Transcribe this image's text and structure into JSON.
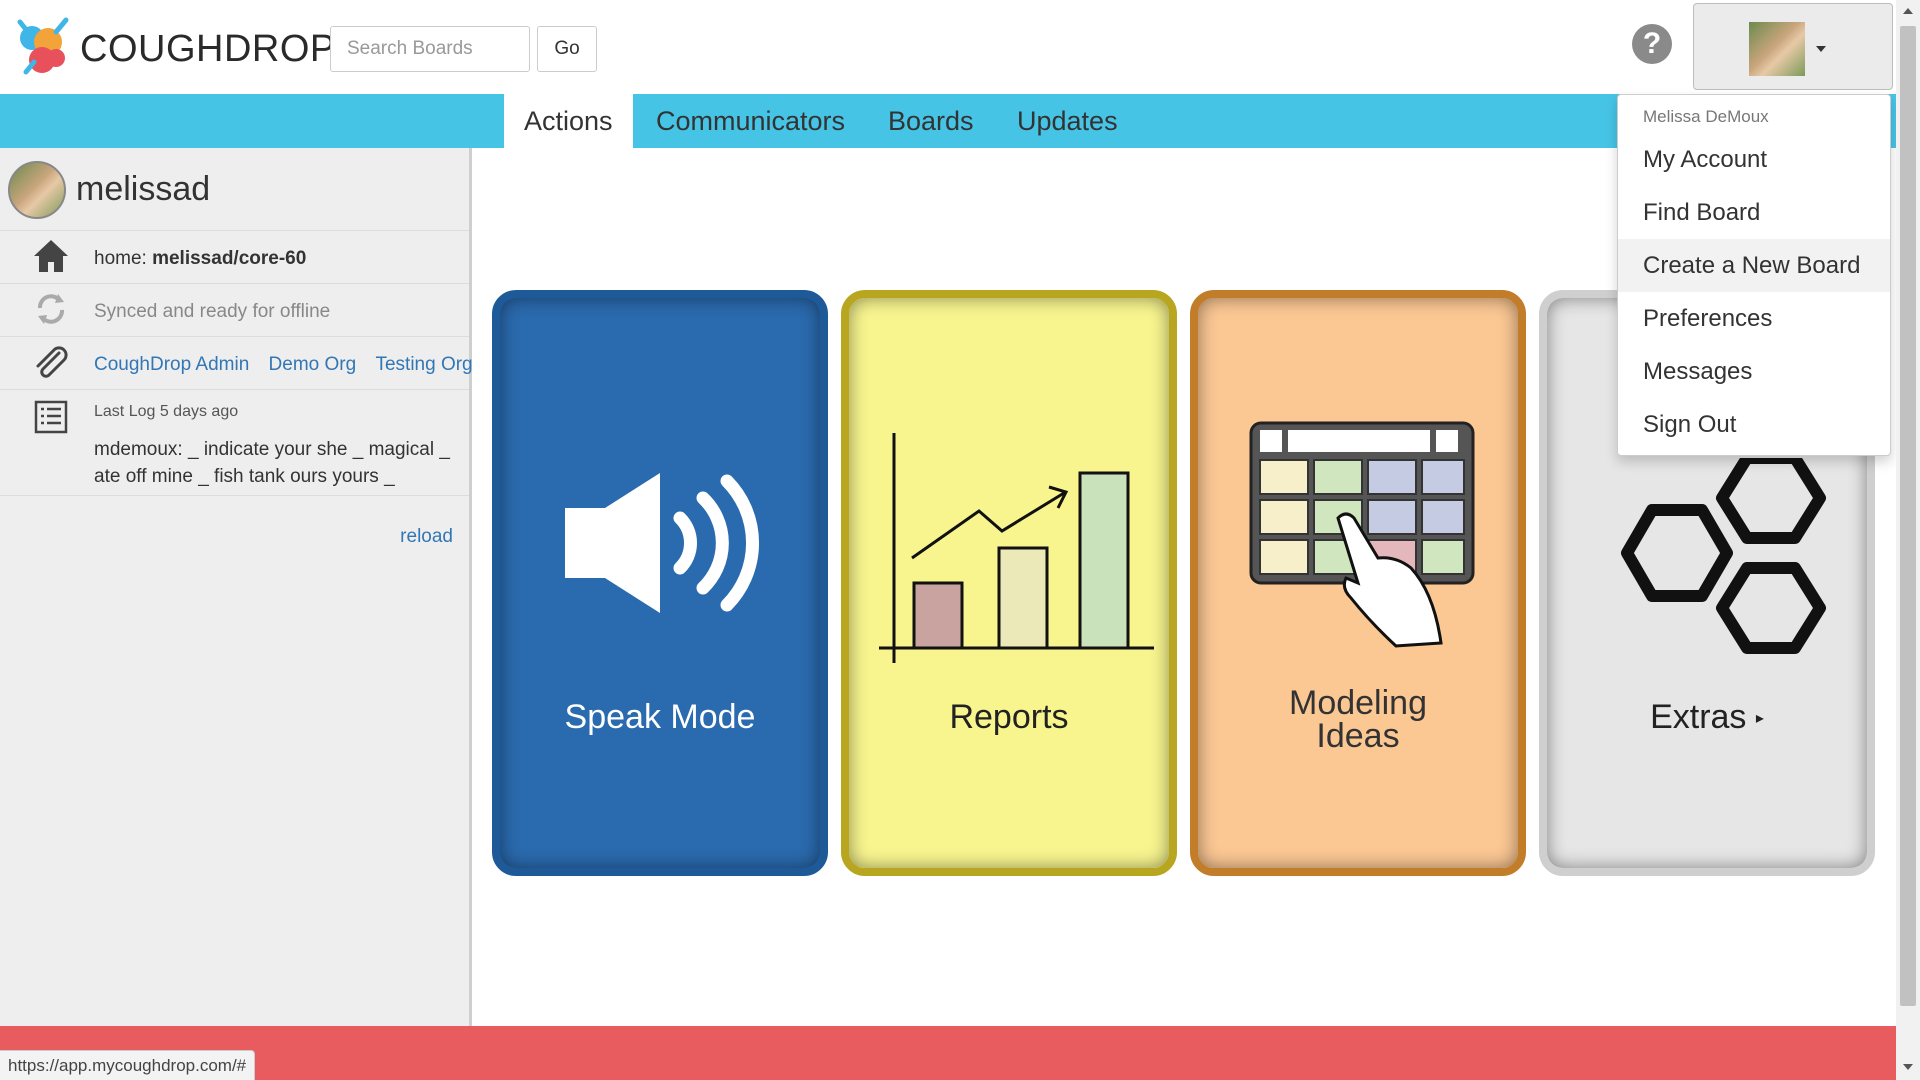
{
  "app": {
    "brand": "COUGHDROP"
  },
  "search": {
    "placeholder": "Search Boards",
    "go_label": "Go"
  },
  "nav": {
    "tabs": [
      {
        "label": "Actions",
        "active": true
      },
      {
        "label": "Communicators",
        "active": false
      },
      {
        "label": "Boards",
        "active": false
      },
      {
        "label": "Updates",
        "active": false
      }
    ]
  },
  "user_menu": {
    "name": "Melissa DeMoux",
    "items": [
      "My Account",
      "Find Board",
      "Create a New Board",
      "Preferences",
      "Messages",
      "Sign Out"
    ],
    "highlighted": "Create a New Board"
  },
  "sidebar": {
    "username": "melissad",
    "home_prefix": "home: ",
    "home_board": "melissad/core-60",
    "sync_status": "Synced and ready for offline",
    "orgs": [
      "CoughDrop Admin",
      "Demo Org",
      "Testing Org"
    ],
    "last_log_label": "Last Log 5 days ago",
    "last_log_text": "mdemoux: _ indicate your she _ magical _ ate off mine _ fish tank ours yours _",
    "reload_label": "reload"
  },
  "cards": [
    {
      "label": "Speak Mode",
      "icon": "speaker-icon",
      "color": "#2a6aae"
    },
    {
      "label": "Reports",
      "icon": "bar-chart-icon",
      "color": "#f8f58f"
    },
    {
      "label": "Modeling",
      "label2": "Ideas",
      "icon": "keyboard-touch-icon",
      "color": "#fbc793"
    },
    {
      "label": "Extras",
      "icon": "hexagons-icon",
      "color": "#e6e6e6"
    }
  ],
  "status_bar": {
    "url": "https://app.mycoughdrop.com/#"
  },
  "colors": {
    "nav": "#46c4e6",
    "footer": "#e85c5f",
    "link": "#3277b5"
  }
}
